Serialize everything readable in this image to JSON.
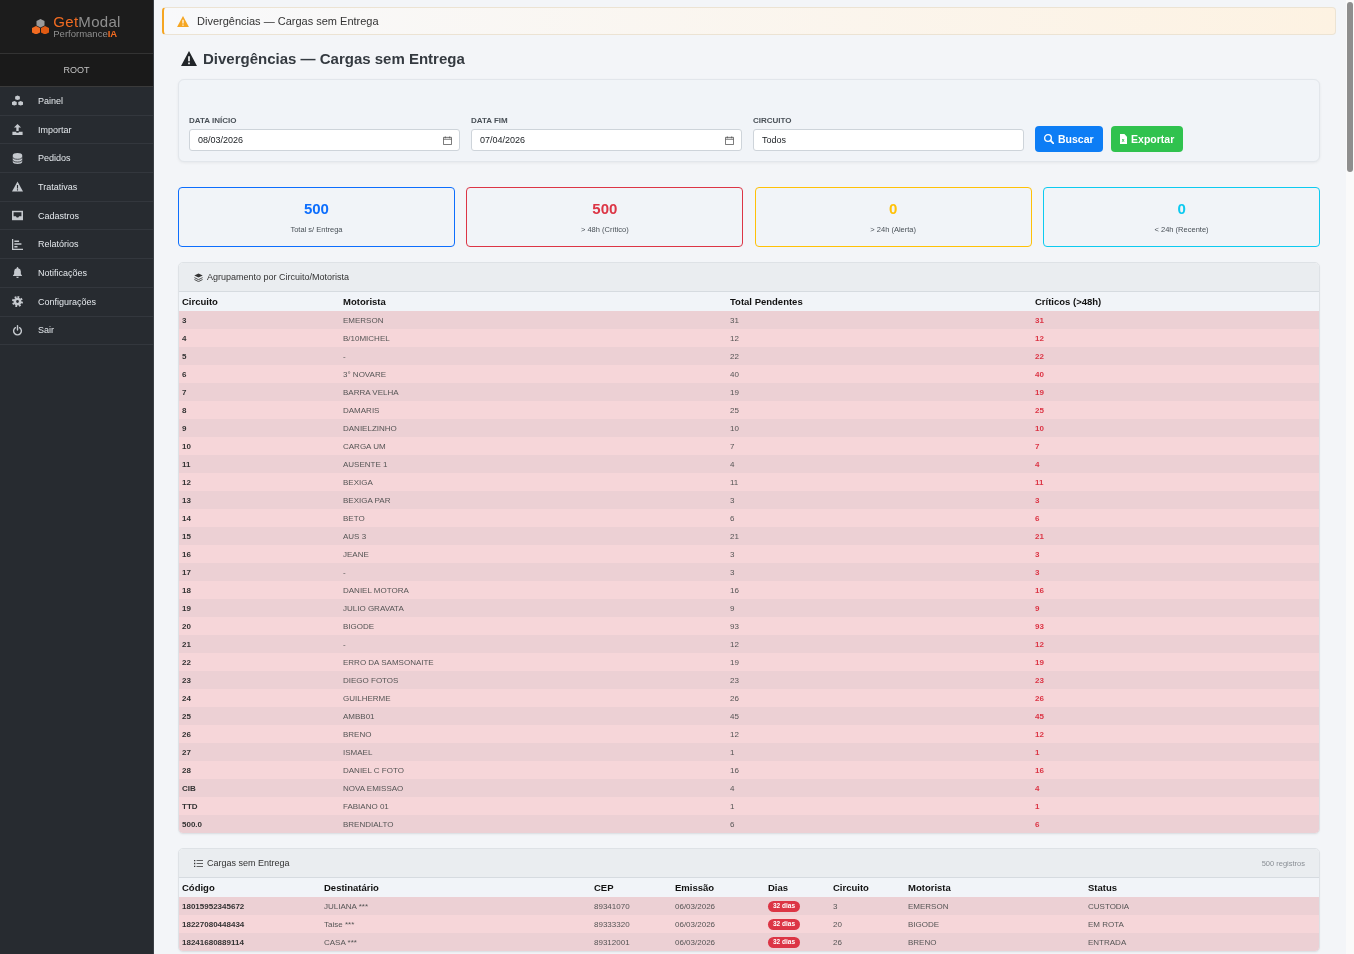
{
  "sidebar": {
    "logo": {
      "name_accent": "Get",
      "name_rest": "Modal",
      "tagline": "Performance",
      "tagline_accent": "IA"
    },
    "user": "ROOT",
    "items": [
      {
        "label": "Painel",
        "selected": false
      },
      {
        "label": "Importar",
        "selected": false
      },
      {
        "label": "Pedidos",
        "selected": false
      },
      {
        "label": "Tratativas",
        "selected": false
      },
      {
        "label": "Cadastros",
        "selected": false
      },
      {
        "label": "Relatórios",
        "selected": false
      },
      {
        "label": "Notificações",
        "selected": false
      },
      {
        "label": "Configurações",
        "selected": false
      },
      {
        "label": "Sair",
        "selected": false
      }
    ]
  },
  "breadcrumb": "Divergências — Cargas sem Entrega",
  "page_title": "Divergências — Cargas sem Entrega",
  "filters": {
    "fields": [
      {
        "label": "DATA INÍCIO",
        "value": "08/03/2026",
        "kind": "date"
      },
      {
        "label": "DATA FIM",
        "value": "07/04/2026",
        "kind": "date"
      },
      {
        "label": "CIRCUITO",
        "value": "Todos",
        "kind": "text"
      }
    ],
    "buttons": [
      {
        "label": "Buscar",
        "kind": "search"
      },
      {
        "label": "Exportar",
        "kind": "export"
      }
    ]
  },
  "stats": [
    {
      "value": "500",
      "label": "Total s/ Entrega",
      "color": "#0d6efd"
    },
    {
      "value": "500",
      "label": "> 48h (Crítico)",
      "color": "#dc3545"
    },
    {
      "value": "0",
      "label": "> 24h (Alerta)",
      "color": "#ffc107"
    },
    {
      "value": "0",
      "label": "< 24h (Recente)",
      "color": "#0dcaf0"
    }
  ],
  "grouping": {
    "title": "Agrupamento por Circuito/Motorista",
    "columns": [
      "Circuito",
      "Motorista",
      "Total Pendentes",
      "Críticos (>48h)"
    ],
    "rows": [
      {
        "circuito": "3",
        "motorista": "EMERSON",
        "total": "31",
        "criticos": "31"
      },
      {
        "circuito": "4",
        "motorista": "B/10MICHEL",
        "total": "12",
        "criticos": "12"
      },
      {
        "circuito": "5",
        "motorista": "-",
        "total": "22",
        "criticos": "22"
      },
      {
        "circuito": "6",
        "motorista": "3° NOVARE",
        "total": "40",
        "criticos": "40"
      },
      {
        "circuito": "7",
        "motorista": "BARRA VELHA",
        "total": "19",
        "criticos": "19"
      },
      {
        "circuito": "8",
        "motorista": "DAMARIS",
        "total": "25",
        "criticos": "25"
      },
      {
        "circuito": "9",
        "motorista": "DANIELZINHO",
        "total": "10",
        "criticos": "10"
      },
      {
        "circuito": "10",
        "motorista": "CARGA UM",
        "total": "7",
        "criticos": "7"
      },
      {
        "circuito": "11",
        "motorista": "AUSENTE 1",
        "total": "4",
        "criticos": "4"
      },
      {
        "circuito": "12",
        "motorista": "BEXIGA",
        "total": "11",
        "criticos": "11"
      },
      {
        "circuito": "13",
        "motorista": "BEXIGA PAR",
        "total": "3",
        "criticos": "3"
      },
      {
        "circuito": "14",
        "motorista": "BETO",
        "total": "6",
        "criticos": "6"
      },
      {
        "circuito": "15",
        "motorista": "AUS 3",
        "total": "21",
        "criticos": "21"
      },
      {
        "circuito": "16",
        "motorista": "JEANE",
        "total": "3",
        "criticos": "3"
      },
      {
        "circuito": "17",
        "motorista": "-",
        "total": "3",
        "criticos": "3"
      },
      {
        "circuito": "18",
        "motorista": "DANIEL MOTORA",
        "total": "16",
        "criticos": "16"
      },
      {
        "circuito": "19",
        "motorista": "JULIO GRAVATA",
        "total": "9",
        "criticos": "9"
      },
      {
        "circuito": "20",
        "motorista": "BIGODE",
        "total": "93",
        "criticos": "93"
      },
      {
        "circuito": "21",
        "motorista": "-",
        "total": "12",
        "criticos": "12"
      },
      {
        "circuito": "22",
        "motorista": "ERRO DA SAMSONAITE",
        "total": "19",
        "criticos": "19"
      },
      {
        "circuito": "23",
        "motorista": "DIEGO FOTOS",
        "total": "23",
        "criticos": "23"
      },
      {
        "circuito": "24",
        "motorista": "GUILHERME",
        "total": "26",
        "criticos": "26"
      },
      {
        "circuito": "25",
        "motorista": "AMBB01",
        "total": "45",
        "criticos": "45"
      },
      {
        "circuito": "26",
        "motorista": "BRENO",
        "total": "12",
        "criticos": "12"
      },
      {
        "circuito": "27",
        "motorista": "ISMAEL",
        "total": "1",
        "criticos": "1"
      },
      {
        "circuito": "28",
        "motorista": "DANIEL C FOTO",
        "total": "16",
        "criticos": "16"
      },
      {
        "circuito": "CIB",
        "motorista": "NOVA EMISSAO",
        "total": "4",
        "criticos": "4"
      },
      {
        "circuito": "TTD",
        "motorista": "FABIANO 01",
        "total": "1",
        "criticos": "1"
      },
      {
        "circuito": "500.0",
        "motorista": "BRENDIALTO",
        "total": "6",
        "criticos": "6"
      }
    ]
  },
  "loads": {
    "title": "Cargas sem Entrega",
    "count": "500 registros",
    "columns": [
      "Código",
      "Destinatário",
      "CEP",
      "Emissão",
      "Dias",
      "Circuito",
      "Motorista",
      "Status"
    ],
    "rows": [
      {
        "codigo": "18015952345672",
        "destinatario": "JULIANA ***",
        "cep": "89341070",
        "emissao": "06/03/2026",
        "dias": "32 dias",
        "circuito": "3",
        "motorista": "EMERSON",
        "status": "CUSTODIA"
      },
      {
        "codigo": "18227080448434",
        "destinatario": "Taise ***",
        "cep": "89333320",
        "emissao": "06/03/2026",
        "dias": "32 dias",
        "circuito": "20",
        "motorista": "BIGODE",
        "status": "EM ROTA"
      },
      {
        "codigo": "18241680889114",
        "destinatario": "CASA ***",
        "cep": "89312001",
        "emissao": "06/03/2026",
        "dias": "32 dias",
        "circuito": "26",
        "motorista": "BRENO",
        "status": "ENTRADA"
      }
    ]
  }
}
